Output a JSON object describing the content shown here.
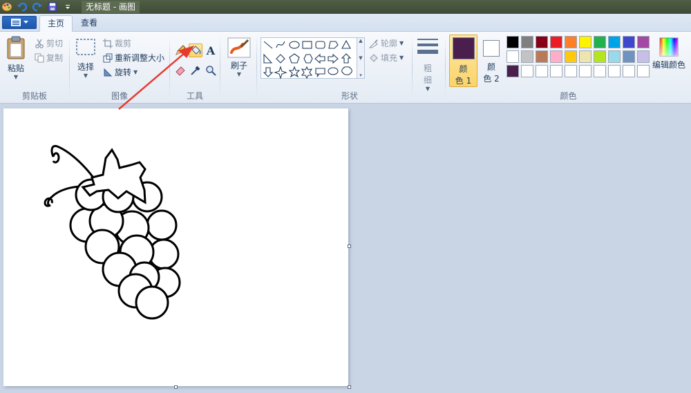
{
  "window": {
    "title": "无标题 - 画图"
  },
  "tabs": [
    {
      "label": "主页",
      "active": true
    },
    {
      "label": "查看",
      "active": false
    }
  ],
  "clipboard": {
    "group_label": "剪贴板",
    "paste": "粘贴",
    "cut": "剪切",
    "copy": "复制"
  },
  "image": {
    "group_label": "图像",
    "select": "选择",
    "crop": "裁剪",
    "resize": "重新调整大小",
    "rotate": "旋转"
  },
  "tools": {
    "group_label": "工具",
    "items": [
      {
        "name": "pencil-icon",
        "selected": false
      },
      {
        "name": "fill-bucket-icon",
        "selected": true
      },
      {
        "name": "text-icon",
        "selected": false,
        "glyph": "A"
      },
      {
        "name": "eraser-icon",
        "selected": false
      },
      {
        "name": "color-picker-icon",
        "selected": false
      },
      {
        "name": "magnifier-icon",
        "selected": false
      }
    ]
  },
  "brushes": {
    "label": "刷子"
  },
  "shapes": {
    "group_label": "形状",
    "outline": "轮廓",
    "fill": "填充",
    "size_label_1": "粗",
    "size_label_2": "细"
  },
  "colors": {
    "group_label": "颜色",
    "color1_label_1": "颜",
    "color1_label_2": "色 1",
    "color2_label_1": "颜",
    "color2_label_2": "色 2",
    "color1": "#4b1f4d",
    "color2": "#ffffff",
    "edit_colors": "编辑颜色",
    "palette_row1": [
      "#000000",
      "#7f7f7f",
      "#880015",
      "#ed1c24",
      "#ff7f27",
      "#fff200",
      "#22b14c",
      "#00a2e8",
      "#3f48cc",
      "#a349a4"
    ],
    "palette_row2": [
      "#ffffff",
      "#c3c3c3",
      "#b97a57",
      "#ffaec9",
      "#ffc90e",
      "#efe4b0",
      "#b5e61d",
      "#99d9ea",
      "#7092be",
      "#c8bfe7"
    ],
    "palette_row3": [
      "#4b1f4d",
      "#ffffff",
      "#ffffff",
      "#ffffff",
      "#ffffff",
      "#ffffff",
      "#ffffff",
      "#ffffff",
      "#ffffff",
      "#ffffff"
    ]
  },
  "annotation": {
    "arrow_color": "#e8392f"
  }
}
